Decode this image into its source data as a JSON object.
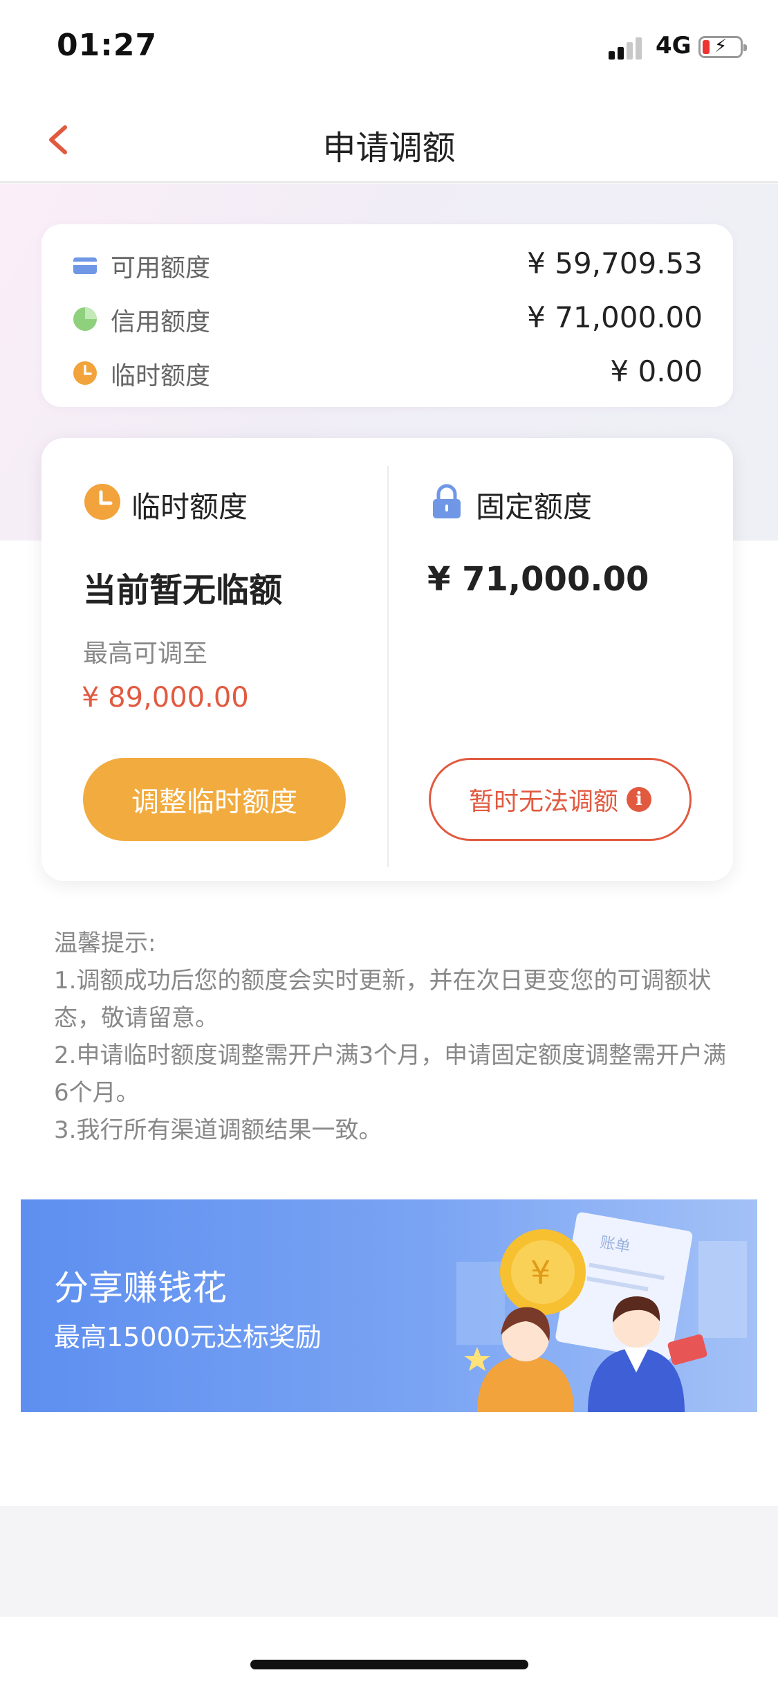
{
  "status_bar": {
    "time": "01:27",
    "network": "4G"
  },
  "nav": {
    "title": "申请调额",
    "back_icon": "chevron-left-icon"
  },
  "summary": {
    "rows": [
      {
        "label": "可用额度",
        "value": "¥ 59,709.53",
        "icon": "card-icon",
        "color": "#6f97e6"
      },
      {
        "label": "信用额度",
        "value": "¥ 71,000.00",
        "icon": "pie-icon",
        "color": "#8fd07d"
      },
      {
        "label": "临时额度",
        "value": "¥ 0.00",
        "icon": "clock-icon",
        "color": "#f2a33c"
      }
    ]
  },
  "temp_limit": {
    "header": "临时额度",
    "status": "当前暂无临额",
    "max_label": "最高可调至",
    "max_value": "¥ 89,000.00",
    "button": "调整临时额度"
  },
  "fixed_limit": {
    "header": "固定额度",
    "value": "¥ 71,000.00",
    "button": "暂时无法调额",
    "info_symbol": "i"
  },
  "tips": {
    "title": "温馨提示:",
    "items": [
      "1.调额成功后您的额度会实时更新，并在次日更变您的可调额状态，敬请留意。",
      "2.申请临时额度调整需开户满3个月，申请固定额度调整需开户满6个月。",
      "3.我行所有渠道调额结果一致。"
    ]
  },
  "banner": {
    "title": "分享赚钱花",
    "subtitle": "最高15000元达标奖励",
    "art_text": "账单"
  },
  "colors": {
    "accent_orange": "#f2ab3e",
    "accent_red": "#e15a40",
    "banner_blue": "#6f9cf2"
  }
}
